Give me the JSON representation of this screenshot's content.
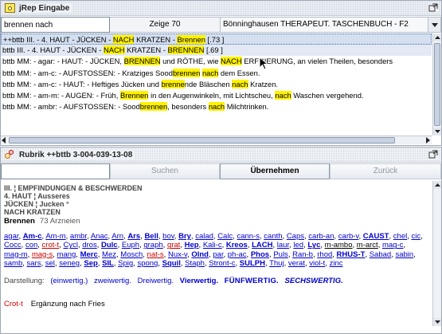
{
  "window1": {
    "title": "jRep Eingabe",
    "search_value": "brennen nach",
    "count_label": "Zeige 70",
    "book_selected": "Bönninghausen THERAPEUT. TASCHENBUCH - F2",
    "rows": [
      [
        "++bttb III. - 4. HAUT - JÜCKEN - ",
        "NACH",
        " KRATZEN - ",
        "Brennen",
        " [.73 ]"
      ],
      [
        "bttb III. - 4. HAUT - JÜCKEN - ",
        "NACH",
        " KRATZEN - ",
        "BRENNEN",
        " [.69 ]"
      ],
      [
        "bttb MM: - agar: - HAUT: - JÜCKEN, ",
        "BRENNEN",
        " und RÖTHE, wie ",
        "NACH",
        " ERFRIERUNG, an vielen Theilen, besonders"
      ],
      [
        "bttb MM: - am-c: - AUFSTOSSEN: - Kratziges Sood",
        "brennen",
        " ",
        "nach",
        " dem Essen."
      ],
      [
        "bttb MM: - am-c: - HAUT: - Heftiges Jücken und ",
        "brenne",
        "nde Bläschen ",
        "nach",
        " Kratzen."
      ],
      [
        "bttb MM: - am-m: - AUGEN: - Früh, ",
        "Brennen",
        " in den Augenwinkeln, mit Lichtscheu, ",
        "nach",
        " Waschen vergehend."
      ],
      [
        "bttb MM: - ambr: - AUFSTOSSEN: - Sood",
        "brennen",
        ", besonders ",
        "nach",
        " Milchtrinken."
      ]
    ]
  },
  "window2": {
    "title": "Rubrik  ++bttb 3-004-039-13-08",
    "buttons": {
      "search": "Suchen",
      "accept": "Übernehmen",
      "back": "Zurück"
    },
    "path": [
      "III. ¦ EMPFINDUNGEN & BESCHWERDEN",
      "4. HAUT ¦ Ausseres",
      "JÜCKEN ¦ Jucken  °",
      "NACH KRATZEN"
    ],
    "rubric_name": "Brennen",
    "rubric_count": "73 Arzneien",
    "remedies": [
      {
        "t": "agar",
        "s": "n"
      },
      {
        "t": "Am-c",
        "s": "b"
      },
      {
        "t": "Am-m",
        "s": "n"
      },
      {
        "t": "ambr",
        "s": "n"
      },
      {
        "t": "Anac",
        "s": "n"
      },
      {
        "t": "Arn",
        "s": "n"
      },
      {
        "t": "Ars",
        "s": "b"
      },
      {
        "t": "Bell",
        "s": "b"
      },
      {
        "t": "bov",
        "s": "n"
      },
      {
        "t": "Bry",
        "s": "b"
      },
      {
        "t": "calad",
        "s": "n"
      },
      {
        "t": "Calc",
        "s": "n"
      },
      {
        "t": "cann-s",
        "s": "n"
      },
      {
        "t": "canth",
        "s": "n"
      },
      {
        "t": "Caps",
        "s": "n"
      },
      {
        "t": "carb-an",
        "s": "n"
      },
      {
        "t": "carb-v",
        "s": "n"
      },
      {
        "t": "CAUST",
        "s": "b"
      },
      {
        "t": "chel",
        "s": "n"
      },
      {
        "t": "cic",
        "s": "n"
      },
      {
        "t": "Cocc",
        "s": "n"
      },
      {
        "t": "con",
        "s": "n"
      },
      {
        "t": "crot-t",
        "s": "r"
      },
      {
        "t": "Cycl",
        "s": "n"
      },
      {
        "t": "dros",
        "s": "n"
      },
      {
        "t": "Dulc",
        "s": "b"
      },
      {
        "t": "Euph",
        "s": "n"
      },
      {
        "t": "graph",
        "s": "n"
      },
      {
        "t": "grat",
        "s": "r"
      },
      {
        "t": "Hep",
        "s": "b"
      },
      {
        "t": "Kali-c",
        "s": "n"
      },
      {
        "t": "Kreos",
        "s": "b"
      },
      {
        "t": "LACH",
        "s": "b"
      },
      {
        "t": "laur",
        "s": "n"
      },
      {
        "t": "led",
        "s": "n"
      },
      {
        "t": "Lyc",
        "s": "b"
      },
      {
        "t": "m-ambo",
        "s": "k"
      },
      {
        "t": "m-arct",
        "s": "k"
      },
      {
        "t": "mag-c",
        "s": "n"
      },
      {
        "t": "mag-m",
        "s": "n"
      },
      {
        "t": "mag-s",
        "s": "r"
      },
      {
        "t": "mang",
        "s": "n"
      },
      {
        "t": "Merc",
        "s": "b"
      },
      {
        "t": "Mez",
        "s": "n"
      },
      {
        "t": "Mosch",
        "s": "n"
      },
      {
        "t": "nat-s",
        "s": "r"
      },
      {
        "t": "Nux-v",
        "s": "n"
      },
      {
        "t": "Olnd",
        "s": "b"
      },
      {
        "t": "par",
        "s": "n"
      },
      {
        "t": "ph-ac",
        "s": "n"
      },
      {
        "t": "Phos",
        "s": "b"
      },
      {
        "t": "Puls",
        "s": "n"
      },
      {
        "t": "Ran-b",
        "s": "n"
      },
      {
        "t": "rhod",
        "s": "n"
      },
      {
        "t": "RHUS-T",
        "s": "b"
      },
      {
        "t": "Sabad",
        "s": "n"
      },
      {
        "t": "sabin",
        "s": "n"
      },
      {
        "t": "samb",
        "s": "n"
      },
      {
        "t": "sars",
        "s": "n"
      },
      {
        "t": "sel",
        "s": "n"
      },
      {
        "t": "seneg",
        "s": "n"
      },
      {
        "t": "Sep",
        "s": "b"
      },
      {
        "t": "SIL",
        "s": "b"
      },
      {
        "t": "Spig",
        "s": "n"
      },
      {
        "t": "spong",
        "s": "n"
      },
      {
        "t": "Squil",
        "s": "b"
      },
      {
        "t": "Staph",
        "s": "n"
      },
      {
        "t": "Stront-c",
        "s": "n"
      },
      {
        "t": "SULPH",
        "s": "b"
      },
      {
        "t": "Thuj",
        "s": "n"
      },
      {
        "t": "verat",
        "s": "n"
      },
      {
        "t": "viol-t",
        "s": "n"
      },
      {
        "t": "zinc",
        "s": "n"
      }
    ],
    "legend_label": "Darstellung:",
    "legend": [
      "(einwertig.)",
      "zweiwertig.",
      "Dreiwertig.",
      "Vierwertig.",
      "FÜNFWERTIG.",
      "SECHSWERTIG."
    ],
    "supplement_code": "Crot-t",
    "supplement_text": "Ergänzung nach Fries"
  },
  "colors": {
    "highlight": "#fff200",
    "remedy": "#0000cc",
    "remedy_red": "#cc0000"
  }
}
